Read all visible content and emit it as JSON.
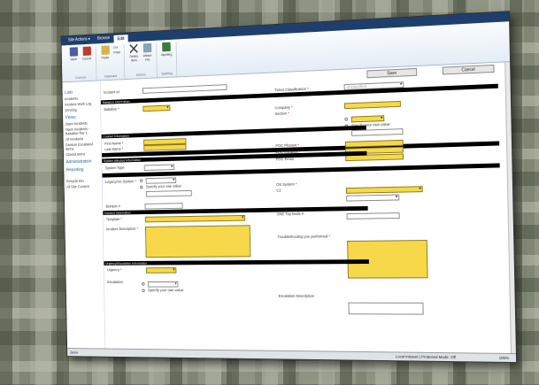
{
  "tabs": [
    "Site Actions ▾",
    "Browse",
    "Edit"
  ],
  "ribbon": {
    "commit": {
      "label": "Commit",
      "save": "Save",
      "cancel": "Cancel"
    },
    "clipboard": {
      "label": "Clipboard",
      "paste": "Paste",
      "cut": "Cut",
      "copy": "Copy"
    },
    "actions": {
      "label": "Actions",
      "delete": "Delete Item",
      "attach": "Attach File"
    },
    "spelling": {
      "label": "Spelling",
      "spelling": "Spelling"
    }
  },
  "nav": {
    "lists_heading": "Lists",
    "lists": [
      "Incidents",
      "Incident Work Log",
      "Errorlog"
    ],
    "views_heading": "Views",
    "views": [
      "Open Incidents",
      "Open Incidents - Battalion Tier 1",
      "All Incidents",
      "Division Escalated Items",
      "Closed Items"
    ],
    "admin_heading": "Administration",
    "reporting_heading": "Reporting",
    "bottom": [
      "Recycle Bin",
      "All Site Content"
    ]
  },
  "buttons": {
    "save": "Save",
    "cancel": "Cancel"
  },
  "fields": {
    "incident_id": "Incident Id",
    "ticket_classification": "Ticket Classification",
    "classification_value": "Unclassified",
    "battalion_info": "Battalion Information",
    "battalion": "Battalion",
    "company": "Company",
    "section": "Section",
    "specify": "Specify your own value:",
    "contact_info": "Contact Information",
    "first_name": "First Name",
    "last_name": "Last Name",
    "poc_phone": "POC Phone#",
    "poc_location": "POC Location",
    "poc_email": "POC Email",
    "system_affected": "System Affected Information",
    "system_type": "System Type",
    "legacy_system": "Legacy/SU System",
    "os_system": "OS System",
    "c2": "C2",
    "bumper": "Bumper #",
    "sne_top_node": "SNE Top Node #:",
    "incident_info": "Incident Information",
    "template": "Template",
    "incident_description": "Incident Description",
    "troubleshooting": "Troubleshooting you performed",
    "urgency_escalation": "Urgency/Escalation Information",
    "urgency": "Urgency",
    "escalation": "Escalation",
    "escalation_description": "Escalation Description"
  },
  "status": {
    "left": "Done",
    "zone": "Local intranet | Protected Mode: Off",
    "zoom": "100%"
  }
}
